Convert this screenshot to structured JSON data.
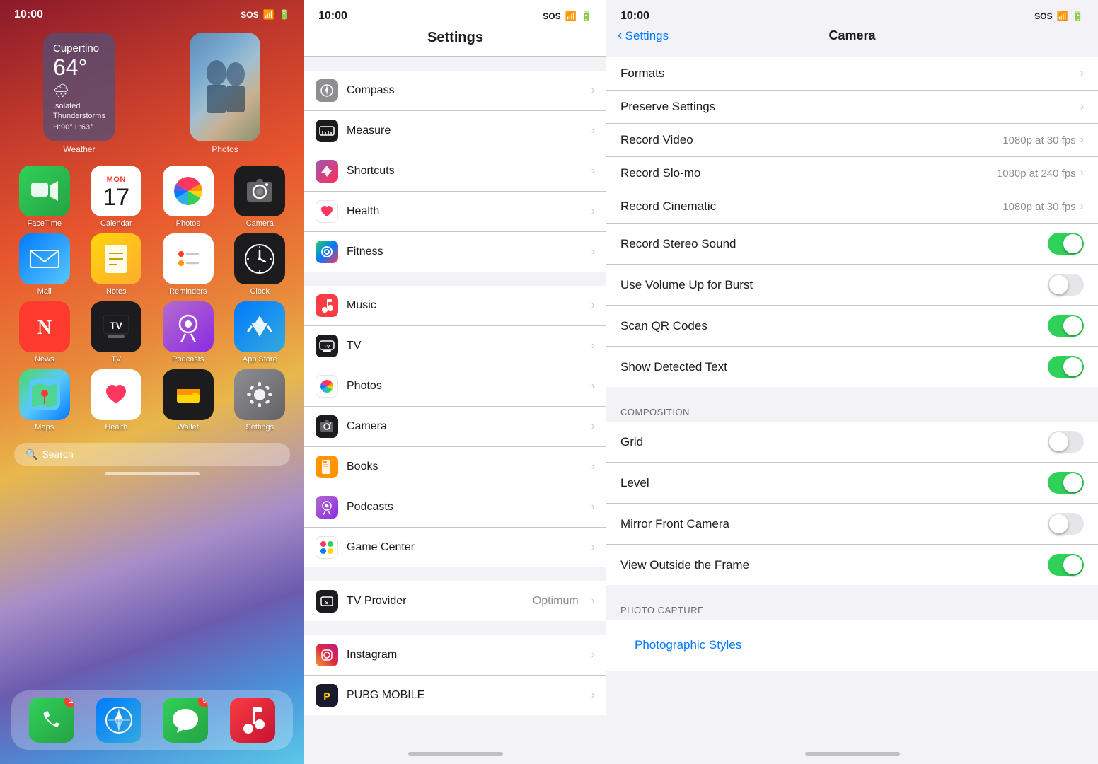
{
  "panel1": {
    "statusBar": {
      "time": "10:00",
      "sos": "SOS",
      "wifi": "wifi",
      "battery": "battery"
    },
    "widgets": {
      "weather": {
        "city": "Cupertino",
        "temp": "64°",
        "icon": "🌧",
        "desc": "Isolated\nThunderstorms",
        "hl": "H:90° L:63°",
        "label": "Weather"
      },
      "photo": {
        "label": "Photos"
      }
    },
    "apps": [
      {
        "id": "facetime",
        "label": "FaceTime",
        "icon": "📹",
        "bg": "facetime"
      },
      {
        "id": "calendar",
        "label": "Calendar",
        "icon": "17",
        "bg": "calendar"
      },
      {
        "id": "photos",
        "label": "Photos",
        "icon": "🌸",
        "bg": "photos"
      },
      {
        "id": "camera",
        "label": "Camera",
        "icon": "📷",
        "bg": "camera"
      },
      {
        "id": "mail",
        "label": "Mail",
        "icon": "✉️",
        "bg": "mail"
      },
      {
        "id": "notes",
        "label": "Notes",
        "icon": "📝",
        "bg": "notes"
      },
      {
        "id": "reminders",
        "label": "Reminders",
        "icon": "📋",
        "bg": "reminders"
      },
      {
        "id": "clock",
        "label": "Clock",
        "icon": "🕐",
        "bg": "clock"
      },
      {
        "id": "news",
        "label": "News",
        "icon": "N",
        "bg": "news"
      },
      {
        "id": "tv",
        "label": "TV",
        "icon": "",
        "bg": "tv"
      },
      {
        "id": "podcasts",
        "label": "Podcasts",
        "icon": "🎙",
        "bg": "podcasts"
      },
      {
        "id": "appstore",
        "label": "App Store",
        "icon": "A",
        "bg": "appstore"
      },
      {
        "id": "maps",
        "label": "Maps",
        "icon": "🗺",
        "bg": "maps"
      },
      {
        "id": "health",
        "label": "Health",
        "icon": "❤️",
        "bg": "health"
      },
      {
        "id": "wallet",
        "label": "Wallet",
        "icon": "💳",
        "bg": "wallet"
      },
      {
        "id": "settings",
        "label": "Settings",
        "icon": "⚙️",
        "bg": "settings"
      }
    ],
    "searchPlaceholder": "Search",
    "dock": [
      {
        "id": "phone",
        "icon": "📞",
        "badge": "1",
        "bg": "facetime"
      },
      {
        "id": "safari",
        "icon": "🧭",
        "badge": "",
        "bg": "appstore"
      },
      {
        "id": "messages",
        "icon": "💬",
        "badge": "5",
        "bg": "facetime"
      },
      {
        "id": "music",
        "icon": "🎵",
        "badge": "",
        "bg": "news"
      }
    ]
  },
  "panel2": {
    "statusBar": {
      "time": "10:00",
      "sos": "SOS"
    },
    "title": "Settings",
    "sections": [
      {
        "items": [
          {
            "label": "Compass",
            "iconBg": "#8E8E93",
            "iconEmoji": "🧭"
          },
          {
            "label": "Measure",
            "iconBg": "#1C1C1E",
            "iconEmoji": "📏"
          },
          {
            "label": "Shortcuts",
            "iconBg": "linear-gradient(135deg,#FF6B6B,#FF2D55)",
            "iconEmoji": "⬡"
          },
          {
            "label": "Health",
            "iconBg": "white",
            "iconEmoji": "❤️"
          },
          {
            "label": "Fitness",
            "iconBg": "linear-gradient(135deg,#30D158,#34C759)",
            "iconEmoji": "⬤"
          }
        ]
      },
      {
        "items": [
          {
            "label": "Music",
            "iconBg": "#FC3C44",
            "iconEmoji": "🎵"
          },
          {
            "label": "TV",
            "iconBg": "#1C1C1E",
            "iconEmoji": "📺"
          },
          {
            "label": "Photos",
            "iconBg": "white",
            "iconEmoji": "🌸"
          },
          {
            "label": "Camera",
            "iconBg": "#1C1C1E",
            "iconEmoji": "📷"
          },
          {
            "label": "Books",
            "iconBg": "#FF9500",
            "iconEmoji": "📖"
          },
          {
            "label": "Podcasts",
            "iconBg": "#B56BCE",
            "iconEmoji": "🎙"
          },
          {
            "label": "Game Center",
            "iconBg": "white",
            "iconEmoji": "🎮"
          }
        ]
      },
      {
        "items": [
          {
            "label": "TV Provider",
            "iconBg": "#1C1C1E",
            "iconEmoji": "📡",
            "value": "Optimum"
          }
        ]
      },
      {
        "items": [
          {
            "label": "Instagram",
            "iconBg": "linear-gradient(45deg,#f09433,#e6683c,#dc2743,#cc2366,#bc1888)",
            "iconEmoji": "📷"
          },
          {
            "label": "PUBG MOBILE",
            "iconBg": "#1C1C1E",
            "iconEmoji": "🎮"
          }
        ]
      }
    ]
  },
  "panel3": {
    "statusBar": {
      "time": "10:00",
      "sos": "SOS"
    },
    "nav": {
      "back": "Settings",
      "title": "Camera"
    },
    "sections": [
      {
        "items": [
          {
            "label": "Formats",
            "type": "chevron"
          },
          {
            "label": "Preserve Settings",
            "type": "chevron"
          },
          {
            "label": "Record Video",
            "value": "1080p at 30 fps",
            "type": "chevron"
          },
          {
            "label": "Record Slo-mo",
            "value": "1080p at 240 fps",
            "type": "chevron"
          },
          {
            "label": "Record Cinematic",
            "value": "1080p at 30 fps",
            "type": "chevron"
          },
          {
            "label": "Record Stereo Sound",
            "type": "toggle",
            "on": true
          },
          {
            "label": "Use Volume Up for Burst",
            "type": "toggle",
            "on": false
          },
          {
            "label": "Scan QR Codes",
            "type": "toggle",
            "on": true
          },
          {
            "label": "Show Detected Text",
            "type": "toggle",
            "on": true
          }
        ]
      },
      {
        "header": "COMPOSITION",
        "items": [
          {
            "label": "Grid",
            "type": "toggle",
            "on": false
          },
          {
            "label": "Level",
            "type": "toggle",
            "on": true
          },
          {
            "label": "Mirror Front Camera",
            "type": "toggle",
            "on": false
          },
          {
            "label": "View Outside the Frame",
            "type": "toggle",
            "on": true
          }
        ]
      },
      {
        "header": "PHOTO CAPTURE",
        "items": [
          {
            "label": "Photographic Styles",
            "type": "link"
          }
        ]
      }
    ]
  }
}
